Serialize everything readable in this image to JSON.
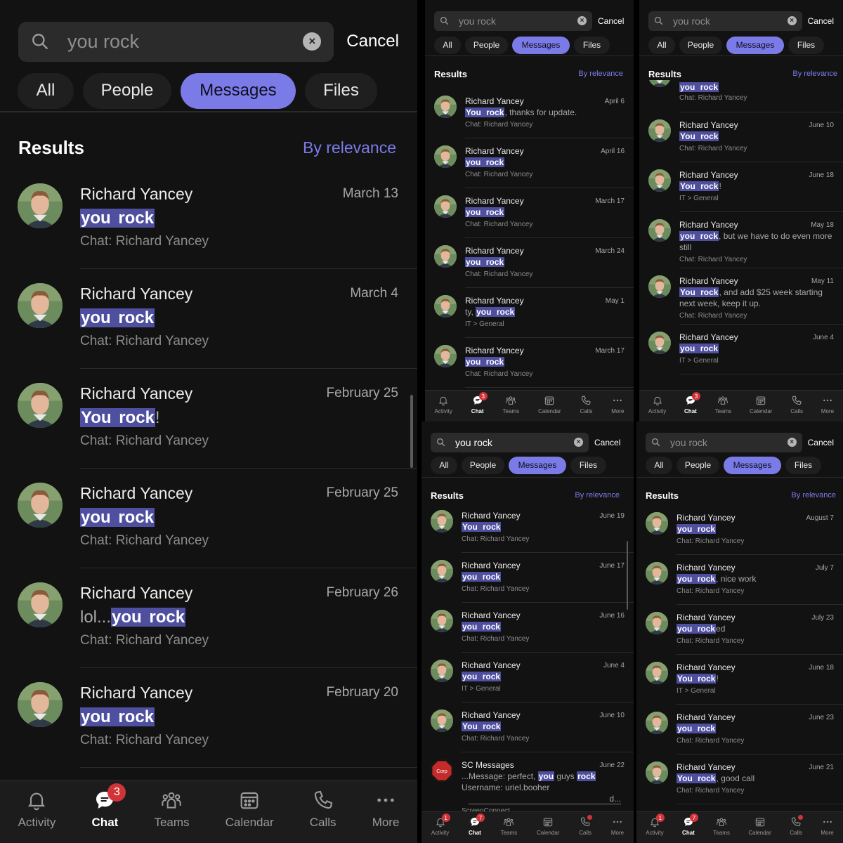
{
  "search": {
    "query": "you rock",
    "cancel_label": "Cancel",
    "filters": [
      "All",
      "People",
      "Messages",
      "Files"
    ],
    "active_filter": "Messages"
  },
  "results": {
    "title": "Results",
    "sort_label": "By relevance"
  },
  "tabs": [
    {
      "label": "Activity",
      "icon": "bell-icon"
    },
    {
      "label": "Chat",
      "icon": "chat-icon"
    },
    {
      "label": "Teams",
      "icon": "teams-icon"
    },
    {
      "label": "Calendar",
      "icon": "calendar-icon"
    },
    {
      "label": "Calls",
      "icon": "phone-icon"
    },
    {
      "label": "More",
      "icon": "more-icon"
    }
  ],
  "colors": {
    "accent": "#7b7be8",
    "highlight": "#4f4fa0",
    "background": "#121212",
    "badge": "#d13438"
  },
  "panels": [
    {
      "id": "panel-1",
      "chat_badge": "3",
      "activity_badge": "",
      "calls_dot": false,
      "items": [
        {
          "name": "Richard Yancey",
          "date": "March 13",
          "pre": "",
          "msg": [
            {
              "t": "you",
              "h": true
            },
            {
              "t": " ",
              "h": true
            },
            {
              "t": "rock",
              "h": true
            }
          ],
          "sub": "Chat: Richard Yancey"
        },
        {
          "name": "Richard Yancey",
          "date": "March 4",
          "pre": "",
          "msg": [
            {
              "t": "you",
              "h": true
            },
            {
              "t": " ",
              "h": true
            },
            {
              "t": "rock",
              "h": true
            }
          ],
          "sub": "Chat: Richard Yancey"
        },
        {
          "name": "Richard Yancey",
          "date": "February 25",
          "pre": "",
          "msg": [
            {
              "t": "You",
              "h": true
            },
            {
              "t": " ",
              "h": true
            },
            {
              "t": "rock",
              "h": true
            },
            {
              "t": "!",
              "h": false
            }
          ],
          "sub": "Chat: Richard Yancey"
        },
        {
          "name": "Richard Yancey",
          "date": "February 25",
          "pre": "",
          "msg": [
            {
              "t": "you",
              "h": true
            },
            {
              "t": " ",
              "h": true
            },
            {
              "t": "rock",
              "h": true
            }
          ],
          "sub": "Chat: Richard Yancey"
        },
        {
          "name": "Richard Yancey",
          "date": "February 26",
          "pre": "",
          "msg": [
            {
              "t": "lol...",
              "h": false
            },
            {
              "t": "you",
              "h": true
            },
            {
              "t": " ",
              "h": true
            },
            {
              "t": "rock",
              "h": true
            }
          ],
          "sub": "Chat: Richard Yancey"
        },
        {
          "name": "Richard Yancey",
          "date": "February 20",
          "pre": "",
          "msg": [
            {
              "t": "you",
              "h": true
            },
            {
              "t": " ",
              "h": true
            },
            {
              "t": "rock",
              "h": true
            }
          ],
          "sub": "Chat: Richard Yancey"
        }
      ]
    },
    {
      "id": "panel-2",
      "chat_badge": "3",
      "activity_badge": "",
      "calls_dot": false,
      "items": [
        {
          "name": "Richard Yancey",
          "date": "April 6",
          "msg": [
            {
              "t": "You",
              "h": true
            },
            {
              "t": " ",
              "h": true
            },
            {
              "t": "rock",
              "h": true
            },
            {
              "t": ", thanks for update.",
              "h": false
            }
          ],
          "sub": "Chat: Richard Yancey"
        },
        {
          "name": "Richard Yancey",
          "date": "April 16",
          "msg": [
            {
              "t": "you",
              "h": true
            },
            {
              "t": " ",
              "h": true
            },
            {
              "t": "rock",
              "h": true
            }
          ],
          "sub": "Chat: Richard Yancey"
        },
        {
          "name": "Richard Yancey",
          "date": "March 17",
          "msg": [
            {
              "t": "you",
              "h": true
            },
            {
              "t": " ",
              "h": true
            },
            {
              "t": "rock",
              "h": true
            }
          ],
          "sub": "Chat: Richard Yancey"
        },
        {
          "name": "Richard Yancey",
          "date": "March 24",
          "msg": [
            {
              "t": "you",
              "h": true
            },
            {
              "t": " ",
              "h": true
            },
            {
              "t": "rock",
              "h": true
            }
          ],
          "sub": "Chat: Richard Yancey"
        },
        {
          "name": "Richard Yancey",
          "date": "May 1",
          "msg": [
            {
              "t": "ty, ",
              "h": false
            },
            {
              "t": "you",
              "h": true
            },
            {
              "t": " ",
              "h": true
            },
            {
              "t": "rock",
              "h": true
            }
          ],
          "sub": "IT > General"
        },
        {
          "name": "Richard Yancey",
          "date": "March 17",
          "msg": [
            {
              "t": "you",
              "h": true
            },
            {
              "t": " ",
              "h": true
            },
            {
              "t": "rock",
              "h": true
            }
          ],
          "sub": "Chat: Richard Yancey"
        }
      ]
    },
    {
      "id": "panel-3",
      "chat_badge": "3",
      "activity_badge": "",
      "calls_dot": false,
      "top_partial": {
        "msg": [
          {
            "t": "you",
            "h": true
          },
          {
            "t": " ",
            "h": true
          },
          {
            "t": "rock",
            "h": true
          }
        ],
        "sub": "Chat: Richard Yancey"
      },
      "items": [
        {
          "name": "Richard Yancey",
          "date": "June 10",
          "msg": [
            {
              "t": "You",
              "h": true
            },
            {
              "t": " ",
              "h": true
            },
            {
              "t": "rock",
              "h": true
            }
          ],
          "sub": "Chat: Richard Yancey"
        },
        {
          "name": "Richard Yancey",
          "date": "June 18",
          "msg": [
            {
              "t": "You",
              "h": true
            },
            {
              "t": " ",
              "h": true
            },
            {
              "t": "rock",
              "h": true
            },
            {
              "t": "!",
              "h": false
            }
          ],
          "sub": "IT > General"
        },
        {
          "name": "Richard Yancey",
          "date": "May 18",
          "msg": [
            {
              "t": "you",
              "h": true
            },
            {
              "t": " ",
              "h": true
            },
            {
              "t": "rock",
              "h": true
            },
            {
              "t": ", but we have to do even more",
              "h": false
            }
          ],
          "msg2": "still",
          "sub": "Chat: Richard Yancey"
        },
        {
          "name": "Richard Yancey",
          "date": "May 11",
          "msg": [
            {
              "t": "You",
              "h": true
            },
            {
              "t": " ",
              "h": true
            },
            {
              "t": "rock",
              "h": true
            },
            {
              "t": ", and add $25 week starting",
              "h": false
            }
          ],
          "msg2": "next week, keep it up.",
          "sub": "Chat: Richard Yancey"
        },
        {
          "name": "Richard Yancey",
          "date": "June 4",
          "msg": [
            {
              "t": "you",
              "h": true
            },
            {
              "t": " ",
              "h": true
            },
            {
              "t": "rock",
              "h": true
            }
          ],
          "sub": "IT > General"
        }
      ]
    },
    {
      "id": "panel-4",
      "chat_badge": "7",
      "activity_badge": "1",
      "calls_dot": true,
      "items": [
        {
          "name": "Richard Yancey",
          "date": "June 19",
          "msg": [
            {
              "t": "You",
              "h": true
            },
            {
              "t": " ",
              "h": true
            },
            {
              "t": "rock",
              "h": true
            }
          ],
          "sub": "Chat: Richard Yancey"
        },
        {
          "name": "Richard Yancey",
          "date": "June 17",
          "msg": [
            {
              "t": "you",
              "h": true
            },
            {
              "t": " ",
              "h": true
            },
            {
              "t": "rock",
              "h": true
            }
          ],
          "sub": "Chat: Richard Yancey"
        },
        {
          "name": "Richard Yancey",
          "date": "June 16",
          "msg": [
            {
              "t": "you",
              "h": true
            },
            {
              "t": " ",
              "h": true
            },
            {
              "t": "rock",
              "h": true
            }
          ],
          "sub": "Chat: Richard Yancey"
        },
        {
          "name": "Richard Yancey",
          "date": "June 4",
          "msg": [
            {
              "t": "you",
              "h": true
            },
            {
              "t": " ",
              "h": true
            },
            {
              "t": "rock",
              "h": true
            }
          ],
          "sub": "IT > General"
        },
        {
          "name": "Richard Yancey",
          "date": "June 10",
          "msg": [
            {
              "t": "You",
              "h": true
            },
            {
              "t": " ",
              "h": true
            },
            {
              "t": "rock",
              "h": true
            }
          ],
          "sub": "Chat: Richard Yancey"
        },
        {
          "name": "SC Messages",
          "date": "June 22",
          "avatar": "stop-sign-icon",
          "msg": [
            {
              "t": "...Message: perfect, ",
              "h": false
            },
            {
              "t": "you",
              "h": true
            },
            {
              "t": " guys ",
              "h": false
            },
            {
              "t": "rock",
              "h": true
            }
          ],
          "msg2": "Username: uriel.booher",
          "msg3": "d...",
          "sub": "ScreenConnect"
        }
      ]
    },
    {
      "id": "panel-5",
      "chat_badge": "7",
      "activity_badge": "1",
      "calls_dot": true,
      "items": [
        {
          "name": "Richard Yancey",
          "date": "August 7",
          "msg": [
            {
              "t": "you",
              "h": true
            },
            {
              "t": " ",
              "h": true
            },
            {
              "t": "rock",
              "h": true
            }
          ],
          "sub": "Chat: Richard Yancey"
        },
        {
          "name": "Richard Yancey",
          "date": "July 7",
          "msg": [
            {
              "t": "you",
              "h": true
            },
            {
              "t": " ",
              "h": true
            },
            {
              "t": "rock",
              "h": true
            },
            {
              "t": ", nice work",
              "h": false
            }
          ],
          "sub": "Chat: Richard Yancey"
        },
        {
          "name": "Richard Yancey",
          "date": "July 23",
          "msg": [
            {
              "t": "you",
              "h": true
            },
            {
              "t": " ",
              "h": true
            },
            {
              "t": "rock",
              "h": true
            },
            {
              "t": "ed",
              "h": false
            }
          ],
          "sub": "Chat: Richard Yancey"
        },
        {
          "name": "Richard Yancey",
          "date": "June 18",
          "msg": [
            {
              "t": "You",
              "h": true
            },
            {
              "t": " ",
              "h": true
            },
            {
              "t": "rock",
              "h": true
            },
            {
              "t": "!",
              "h": false
            }
          ],
          "sub": "IT > General"
        },
        {
          "name": "Richard Yancey",
          "date": "June 23",
          "msg": [
            {
              "t": "you",
              "h": true
            },
            {
              "t": " ",
              "h": true
            },
            {
              "t": "rock",
              "h": true
            }
          ],
          "sub": "Chat: Richard Yancey"
        },
        {
          "name": "Richard Yancey",
          "date": "June 21",
          "msg": [
            {
              "t": "You",
              "h": true
            },
            {
              "t": " ",
              "h": true
            },
            {
              "t": "rock",
              "h": true
            },
            {
              "t": ", good call",
              "h": false
            }
          ],
          "sub": "Chat: Richard Yancey"
        }
      ]
    }
  ]
}
